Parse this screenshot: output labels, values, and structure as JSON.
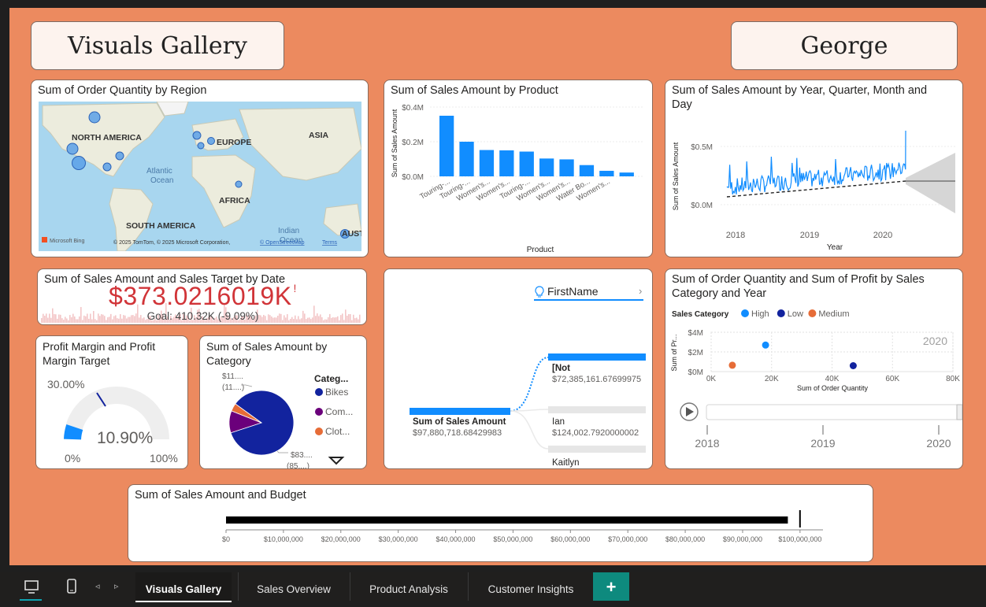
{
  "report": {
    "title": "Visuals Gallery",
    "user": "George"
  },
  "map": {
    "title": "Sum of Order Quantity by Region",
    "labels": {
      "north_america": "NORTH AMERICA",
      "europe": "EUROPE",
      "asia": "ASIA",
      "africa": "AFRICA",
      "south_america": "SOUTH AMERICA",
      "atlantic": "Atlantic",
      "ocean": "Ocean",
      "indian": "Indian",
      "indian_ocean": "Ocean",
      "aust": "AUST"
    },
    "bing": "Microsoft Bing",
    "copyright": "© 2025 TomTom, © 2025 Microsoft Corporation,",
    "osm": "© OpenStreetMap",
    "terms": "Terms"
  },
  "product_chart": {
    "title": "Sum of Sales Amount by Product",
    "chart_data": {
      "type": "bar",
      "xlabel": "Product",
      "ylabel": "Sum of Sales Amount",
      "ylim": [
        0,
        400000
      ],
      "yticks": [
        "$0.0M",
        "$0.2M",
        "$0.4M"
      ],
      "categories": [
        "Touring-...",
        "Touring-...",
        "Women's...",
        "Women's...",
        "Touring-...",
        "Women's...",
        "Women's...",
        "Water Bo...",
        "Women's...",
        ""
      ],
      "values": [
        350000,
        200000,
        152000,
        150000,
        143000,
        103000,
        98000,
        65000,
        32000,
        22000
      ],
      "color": "#118dff"
    }
  },
  "date_chart": {
    "title": "Sum of Sales Amount by Year, Quarter, Month and Day",
    "title_line1": "Sum of Sales Amount by Year, Quarter, Month and",
    "title_line2": "Day",
    "chart_data": {
      "type": "line",
      "xlabel": "Year",
      "ylabel": "Sum of Sales Amount",
      "yticks": [
        "$0.0M",
        "$0.5M"
      ],
      "xticks": [
        "2018",
        "2019",
        "2020"
      ],
      "color": "#118dff",
      "trend": "dashed",
      "forecast": true
    }
  },
  "kpi": {
    "title": "Sum of Sales Amount and Sales Target by Date",
    "value": "$373.0216019K",
    "indicator": "!",
    "goal": "Goal: 410.32K (-9.09%)",
    "color": "#d13438"
  },
  "gauge": {
    "title_line1": "Profit Margin and Profit",
    "title_line2": "Margin Target",
    "value": "10.90%",
    "target_label": "30.00%",
    "min": "0%",
    "max": "100%",
    "chart_data": {
      "type": "gauge",
      "value": 10.9,
      "target": 30,
      "min": 0,
      "max": 100
    }
  },
  "pie": {
    "title_line1": "Sum of Sales Amount by",
    "title_line2": "Category",
    "labels": {
      "top_a": "$11....",
      "top_b": "(11....)",
      "bottom_a": "$83....",
      "bottom_b": "(85....)"
    },
    "legend_title": "Categ...",
    "chart_data": {
      "type": "pie",
      "categories": [
        "Bikes",
        "Com...",
        "Clot..."
      ],
      "values": [
        85,
        11,
        4
      ],
      "colors": [
        "#12239e",
        "#6b007b",
        "#e66c37"
      ]
    }
  },
  "decomp": {
    "field": "FirstName",
    "root_label": "Sum of Sales Amount",
    "root_value": "$97,880,718.68429983",
    "nodes": [
      {
        "label": "[Not",
        "value": "$72,385,161.67699975"
      },
      {
        "label": "Ian",
        "value": "$124,002.7920000002"
      },
      {
        "label": "Kaitlyn",
        "value": ""
      }
    ]
  },
  "scatter": {
    "title_line1": "Sum of Order Quantity and Sum of Profit by Sales",
    "title_line2": "Category and Year",
    "legend_title": "Sales Category",
    "play_axis": [
      "2018",
      "2019",
      "2020"
    ],
    "year_label": "2020",
    "chart_data": {
      "type": "scatter",
      "xlabel": "Sum of Order Quantity",
      "ylabel": "Sum of Pr...",
      "xticks": [
        "0K",
        "20K",
        "40K",
        "60K",
        "80K"
      ],
      "yticks": [
        "$0M",
        "$2M",
        "$4M"
      ],
      "xlim": [
        0,
        80000
      ],
      "ylim": [
        0,
        4000000
      ],
      "series": [
        {
          "name": "High",
          "color": "#118dff",
          "x": [
            18000
          ],
          "y": [
            2700000
          ]
        },
        {
          "name": "Low",
          "color": "#12239e",
          "x": [
            47000
          ],
          "y": [
            600000
          ]
        },
        {
          "name": "Medium",
          "color": "#e66c37",
          "x": [
            7000
          ],
          "y": [
            650000
          ]
        }
      ]
    }
  },
  "bullet": {
    "title": "Sum of Sales Amount and Budget",
    "chart_data": {
      "type": "bar",
      "value": 97880718,
      "target": 100000000,
      "xlim": [
        0,
        104000000
      ],
      "xticks": [
        "$0",
        "$10,000,000",
        "$20,000,000",
        "$30,000,000",
        "$40,000,000",
        "$50,000,000",
        "$60,000,000",
        "$70,000,000",
        "$80,000,000",
        "$90,000,000",
        "$100,000,000"
      ]
    }
  },
  "tabs": [
    {
      "label": "Visuals Gallery",
      "active": true
    },
    {
      "label": "Sales Overview",
      "active": false
    },
    {
      "label": "Product Analysis",
      "active": false
    },
    {
      "label": "Customer Insights",
      "active": false
    }
  ],
  "add_tab": "+"
}
